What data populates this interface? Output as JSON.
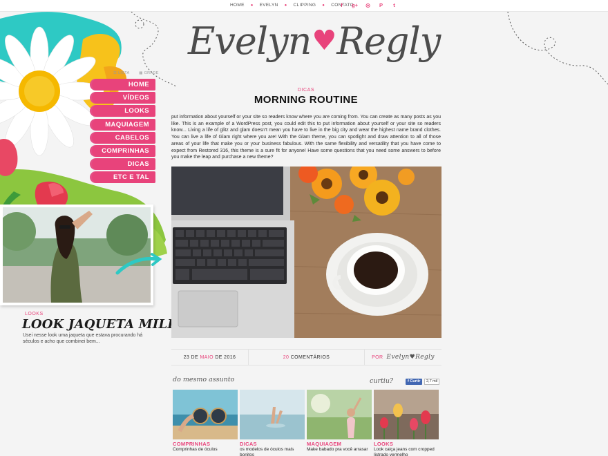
{
  "topnav": {
    "items": [
      "HOME",
      "EVELYN",
      "CLIPPING",
      "CONTATO"
    ],
    "social_icons": [
      "facebook-icon",
      "googleplus-icon",
      "instagram-icon",
      "pinterest-icon",
      "twitter-icon"
    ],
    "social_glyphs": [
      "f",
      "g+",
      "◎",
      "P",
      "t"
    ]
  },
  "logo": {
    "first": "Evelyn",
    "heart": "♥",
    "last": "Regly"
  },
  "view_toggle": {
    "list": "LISTA",
    "grid": "GRADE"
  },
  "sidebar": {
    "menu": [
      "HOME",
      "VÍDEOS",
      "LOOKS",
      "MAQUIAGEM",
      "CABELOS",
      "COMPRINHAS",
      "DICAS",
      "ETC E TAL"
    ],
    "featured": {
      "category": "LOOKS",
      "title": "LOOK JAQUETA MILITAR",
      "excerpt": "Usei nesse look uma jaqueta que estava procurando há séculos e acho que combinei bem..."
    }
  },
  "post": {
    "category": "DICAS",
    "title": "MORNING ROUTINE",
    "body": "put information about yourself or your site so readers know where you are coming from. You can create as many posts as you like. This is an example of a WordPress post, you could edit this to put information about yourself or your site so readers know... Living a life of glitz and glam doesn't mean you have to live in the big city and wear the highest name brand clothes. You can live a life of Glam right where you are! With the  Glam theme, you can spotlight and draw attention to all of those areas of your life that make you or your business fabulous. With the same flexibility and versatility that you have come to expect from Restored 316, this theme is a sure fit for anyone! Have some questions that you need some answers to before you make the leap and purchase a new theme?",
    "date": {
      "day": "23 DE",
      "month": "MAIO",
      "year": "DE 2016"
    },
    "comments": {
      "count": "20",
      "label": "COMENTÁRIOS"
    },
    "author": {
      "label": "POR",
      "signature": "Evelyn♥Regly"
    }
  },
  "related": {
    "heading": "do mesmo assunto",
    "curtiu": "curtiu?",
    "fb_label": "Curtir",
    "fb_count": "2,7 mil",
    "items": [
      {
        "category": "COMPRINHAS",
        "title": "Comprinhas de óculos"
      },
      {
        "category": "DICAS",
        "title": "os modelos de óculos mais bonitos"
      },
      {
        "category": "MAQUIAGEM",
        "title": "Make babado pra você arrasar"
      },
      {
        "category": "LOOKS",
        "title": "Look calça jeans com cropped listrado vermelho"
      }
    ]
  },
  "colors": {
    "accent": "#e8437b",
    "text": "#333333",
    "background": "#f4f4f4"
  }
}
